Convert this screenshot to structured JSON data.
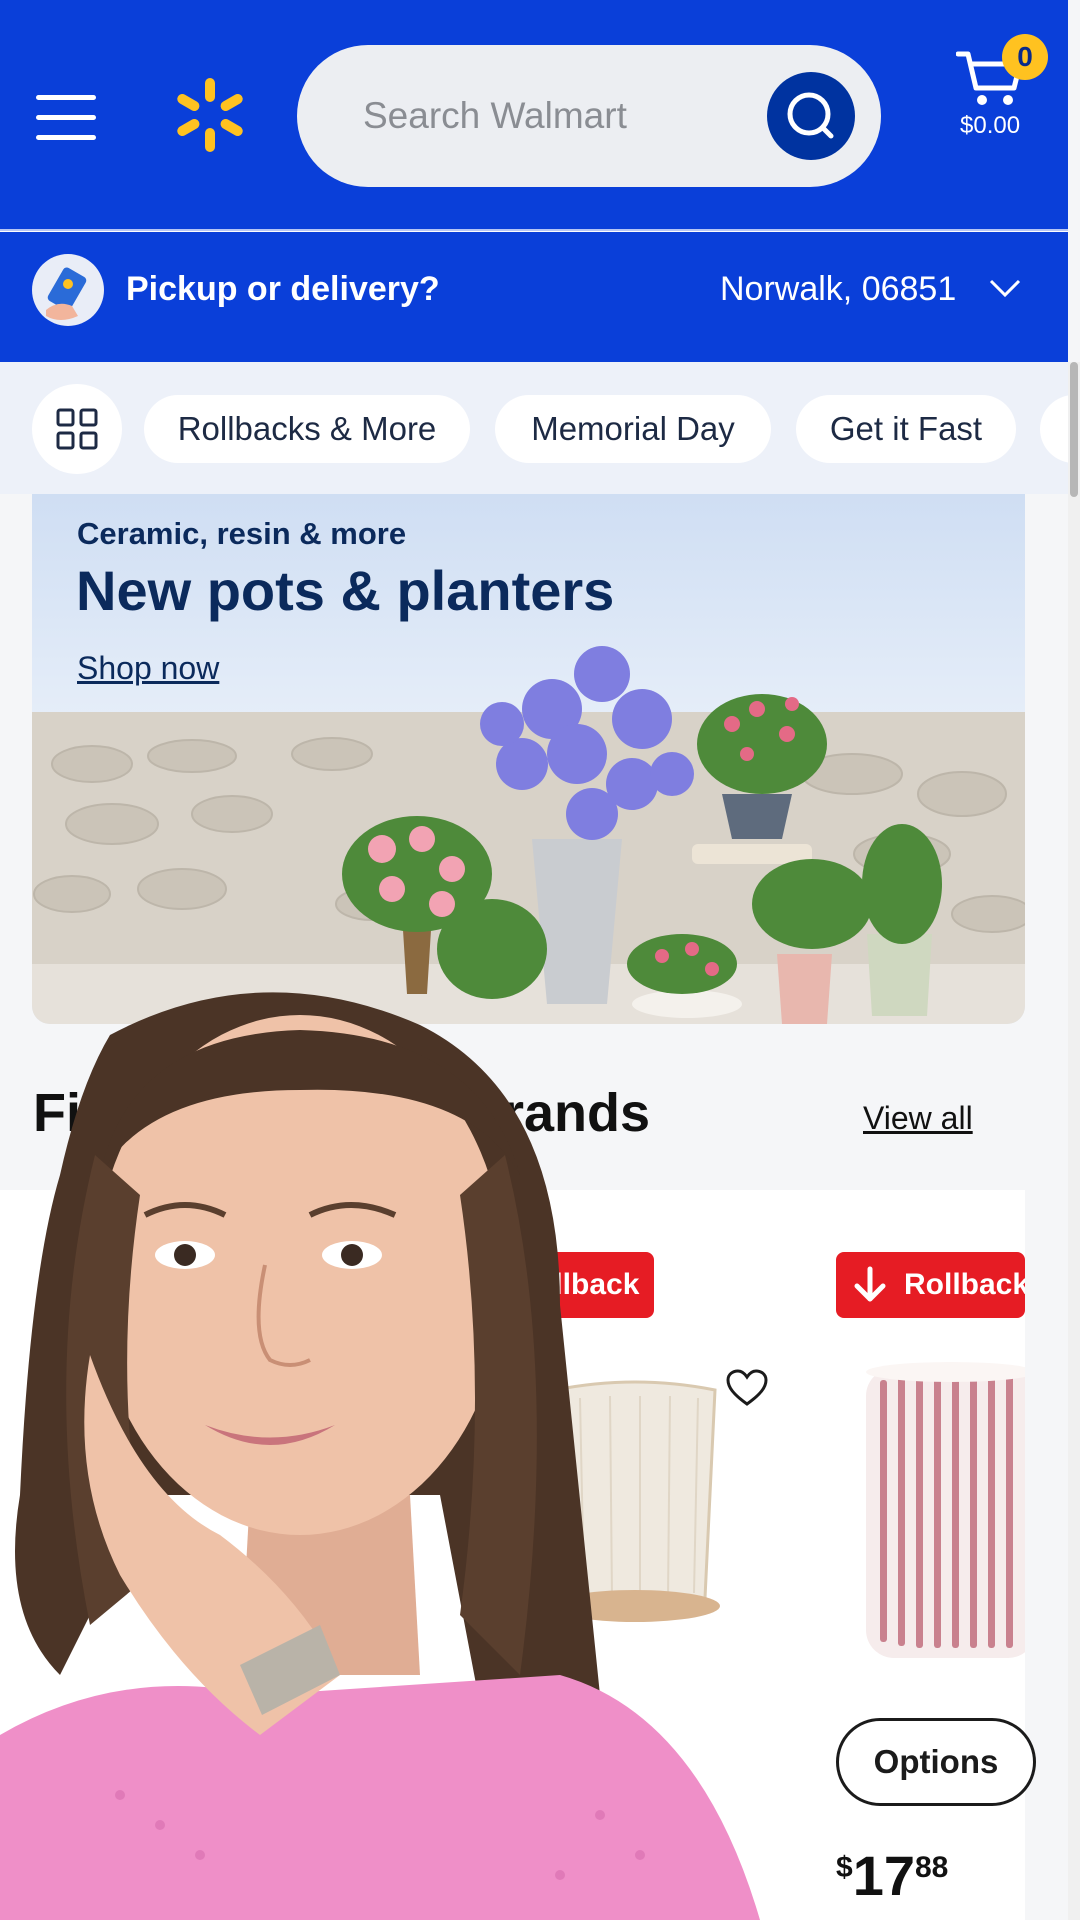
{
  "header": {
    "search_placeholder": "Search Walmart",
    "cart_count": "0",
    "cart_total": "$0.00"
  },
  "pickup": {
    "label": "Pickup or delivery?",
    "location": "Norwalk, 06851"
  },
  "chips": [
    "Rollbacks & More",
    "Memorial Day",
    "Get it Fast"
  ],
  "banner": {
    "subtitle": "Ceramic, resin & more",
    "title": "New pots & planters",
    "link": "Shop now"
  },
  "section": {
    "title_start": "Fi",
    "title_end": "brands",
    "view_all": "View all"
  },
  "products": [
    {
      "badge": "ollback"
    },
    {
      "badge": "Rollback",
      "options_label": "Options",
      "price_currency": "$",
      "price_dollars": "17",
      "price_cents": "88"
    }
  ],
  "colors": {
    "header_blue": "#0a3fd9",
    "spark_yellow": "#ffc220",
    "rollback_red": "#e61c24"
  },
  "icons": [
    "menu-icon",
    "walmart-spark-logo",
    "search-icon",
    "cart-icon",
    "pickup-delivery-icon",
    "chevron-down-icon",
    "grid-icon",
    "heart-icon",
    "arrow-down-icon"
  ]
}
